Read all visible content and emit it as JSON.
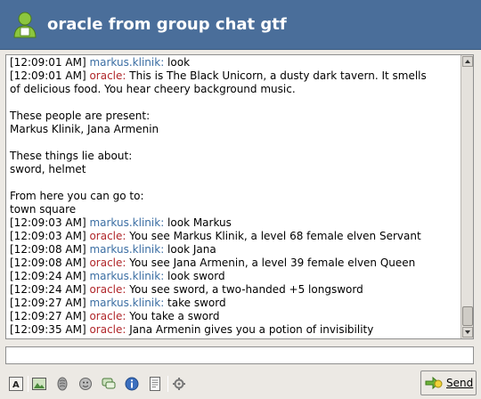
{
  "window": {
    "title": "oracle from group chat gtf"
  },
  "conversation": {
    "lines": [
      {
        "time": "[12:09:01 AM]",
        "nick": "markus.klinik:",
        "nick_type": "local",
        "text": " look"
      },
      {
        "time": "[12:09:01 AM]",
        "nick": "oracle:",
        "nick_type": "remote",
        "text": " This is The Black Unicorn, a dusty dark tavern. It smells"
      },
      {
        "time": "",
        "nick": "",
        "nick_type": "",
        "text": "of delicious food. You hear cheery background music."
      },
      {
        "time": "",
        "nick": "",
        "nick_type": "",
        "text": ""
      },
      {
        "time": "",
        "nick": "",
        "nick_type": "",
        "text": "These people are present:"
      },
      {
        "time": "",
        "nick": "",
        "nick_type": "",
        "text": "Markus Klinik, Jana Armenin"
      },
      {
        "time": "",
        "nick": "",
        "nick_type": "",
        "text": ""
      },
      {
        "time": "",
        "nick": "",
        "nick_type": "",
        "text": "These things lie about:"
      },
      {
        "time": "",
        "nick": "",
        "nick_type": "",
        "text": "sword, helmet"
      },
      {
        "time": "",
        "nick": "",
        "nick_type": "",
        "text": ""
      },
      {
        "time": "",
        "nick": "",
        "nick_type": "",
        "text": "From here you can go to:"
      },
      {
        "time": "",
        "nick": "",
        "nick_type": "",
        "text": "town square"
      },
      {
        "time": "[12:09:03 AM]",
        "nick": "markus.klinik:",
        "nick_type": "local",
        "text": " look Markus"
      },
      {
        "time": "[12:09:03 AM]",
        "nick": "oracle:",
        "nick_type": "remote",
        "text": " You see Markus Klinik, a level 68 female elven Servant"
      },
      {
        "time": "[12:09:08 AM]",
        "nick": "markus.klinik:",
        "nick_type": "local",
        "text": " look Jana"
      },
      {
        "time": "[12:09:08 AM]",
        "nick": "oracle:",
        "nick_type": "remote",
        "text": " You see Jana Armenin, a level 39 female elven Queen"
      },
      {
        "time": "[12:09:24 AM]",
        "nick": "markus.klinik:",
        "nick_type": "local",
        "text": " look sword"
      },
      {
        "time": "[12:09:24 AM]",
        "nick": "oracle:",
        "nick_type": "remote",
        "text": " You see sword, a two-handed +5 longsword"
      },
      {
        "time": "[12:09:27 AM]",
        "nick": "markus.klinik:",
        "nick_type": "local",
        "text": " take sword"
      },
      {
        "time": "[12:09:27 AM]",
        "nick": "oracle:",
        "nick_type": "remote",
        "text": " You take a sword"
      },
      {
        "time": "[12:09:35 AM]",
        "nick": "oracle:",
        "nick_type": "remote",
        "text": " Jana Armenin gives you a potion of invisibility"
      }
    ]
  },
  "input": {
    "value": ""
  },
  "toolbar": {
    "icons": [
      "font-icon",
      "insert-image-icon",
      "attention-icon",
      "smiley-icon",
      "chat-icon",
      "info-icon",
      "log-icon",
      "plugin-icon"
    ],
    "send_label": "Send"
  },
  "colors": {
    "header": "#4a6e9a",
    "remote_nick": "#b0262a",
    "local_nick": "#3b6ea3"
  }
}
